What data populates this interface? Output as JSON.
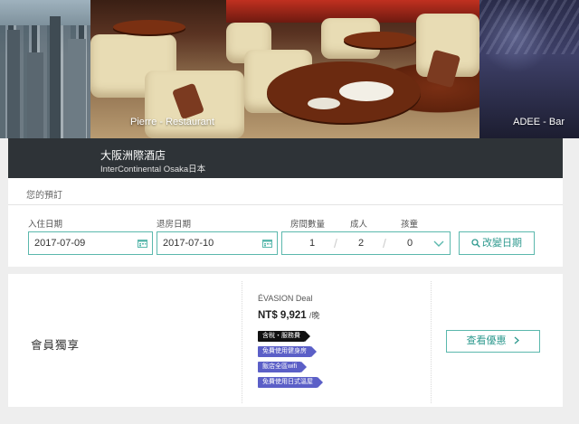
{
  "hero": {
    "photos": [
      {
        "id": "city",
        "label": ""
      },
      {
        "id": "restaurant",
        "label": "Pierre - Restaurant"
      },
      {
        "id": "bar",
        "label": "ADEE - Bar"
      }
    ]
  },
  "hotel": {
    "name": "大阪洲際酒店",
    "subtitle": "InterContinental Osaka日本"
  },
  "booking": {
    "title": "您的預訂",
    "checkin_label": "入住日期",
    "checkin_value": "2017-07-09",
    "checkout_label": "退房日期",
    "checkout_value": "2017-07-10",
    "rooms_label": "房間數量",
    "rooms_value": "1",
    "adults_label": "成人",
    "adults_value": "2",
    "children_label": "孩童",
    "children_value": "0",
    "change_button": "改變日期"
  },
  "offer": {
    "section_title": "會員獨享",
    "deal_name": "ÉVASION Deal",
    "price": "NT$ 9,921",
    "price_unit": "/晚",
    "tags": [
      {
        "label": "含稅・服務費",
        "color": "#111111"
      },
      {
        "label": "免費使用健身房",
        "color": "#5b5fc7"
      },
      {
        "label": "飯店全區wifi",
        "color": "#5b5fc7"
      },
      {
        "label": "免費使用日式溫屋",
        "color": "#5b5fc7"
      }
    ],
    "view_button": "查看優惠"
  },
  "colors": {
    "accent": "#5bb8ad",
    "accent_text": "#2f9a8f",
    "hotel_bar": "#2e3337",
    "tag_dark": "#111111",
    "tag_purple": "#5b5fc7"
  }
}
